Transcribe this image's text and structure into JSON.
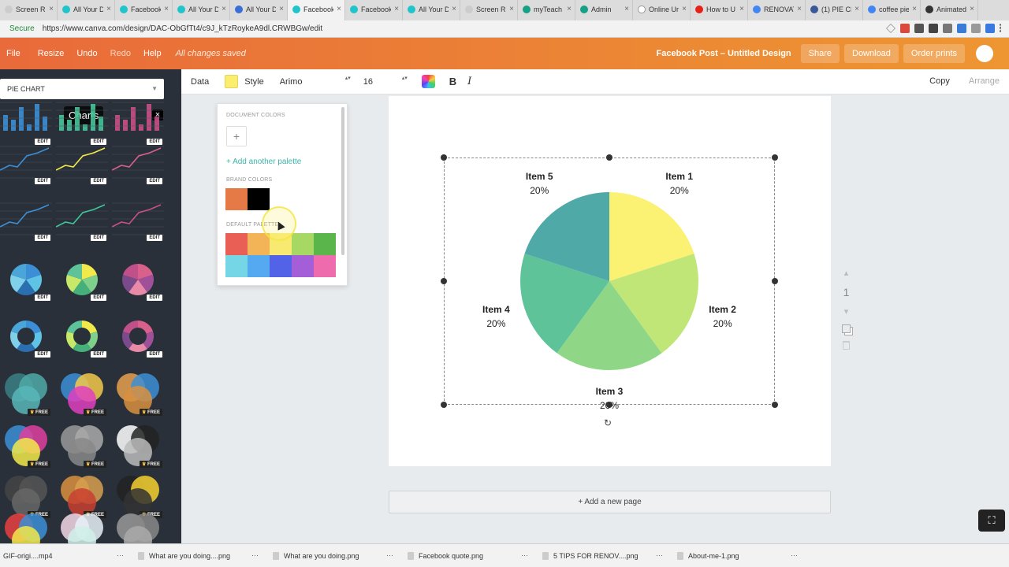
{
  "browser": {
    "tabs": [
      {
        "label": "Screen R",
        "color": "#cccccc"
      },
      {
        "label": "All Your D",
        "color": "#20c4cb"
      },
      {
        "label": "Facebook",
        "color": "#20c4cb"
      },
      {
        "label": "All Your D",
        "color": "#20c4cb"
      },
      {
        "label": "All Your D",
        "color": "#3a6fd8"
      },
      {
        "label": "Facebook",
        "color": "#20c4cb",
        "active": true
      },
      {
        "label": "Facebook",
        "color": "#20c4cb"
      },
      {
        "label": "All Your D",
        "color": "#20c4cb"
      },
      {
        "label": "Screen R",
        "color": "#cccccc"
      },
      {
        "label": "myTeach",
        "color": "#16a085"
      },
      {
        "label": "Admin",
        "color": "#16a085"
      },
      {
        "label": "Online Ur",
        "color": "#ffffff"
      },
      {
        "label": "How to U",
        "color": "#e62117"
      },
      {
        "label": "RENOVAT",
        "color": "#4285f4"
      },
      {
        "label": "(1) PIE CH",
        "color": "#3b5998"
      },
      {
        "label": "coffee pie",
        "color": "#4285f4"
      },
      {
        "label": "Animated",
        "color": "#333333"
      }
    ],
    "close_glyph": "×",
    "secure_label": "Secure",
    "url": "https://www.canva.com/design/DAC-ObGfTt4/c9J_kTzRoykeA9dl.CRWBGw/edit"
  },
  "header": {
    "menu": [
      "File",
      "Resize",
      "Undo",
      "Redo",
      "Help"
    ],
    "saved": "All changes saved",
    "doc_title": "Facebook Post – Untitled Design",
    "share": "Share",
    "download": "Download",
    "order_prints": "Order prints"
  },
  "left_panel": {
    "select_value": "PIE CHART",
    "tooltip": "Charts",
    "close": "×",
    "edit_badge": "EDIT",
    "free_badge": "FREE"
  },
  "toolbar": {
    "data": "Data",
    "style": "Style",
    "font": "Arimo",
    "size": "16",
    "bold": "B",
    "italic": "I",
    "copy": "Copy",
    "arrange": "Arrange",
    "spinner": "▴▾"
  },
  "palette": {
    "document_colors": "DOCUMENT COLORS",
    "add_glyph": "+",
    "add_palette": "+ Add another palette",
    "brand_colors": "BRAND COLORS",
    "brand": [
      "#e57a47",
      "#000000"
    ],
    "default_palette": "DEFAULT PALETTE",
    "default": [
      "#e95f55",
      "#f2b457",
      "#f8ea70",
      "#a7d863",
      "#5ab54a",
      "#75d6e6",
      "#55a9f0",
      "#5263e8",
      "#a45ed8",
      "#ee6bae"
    ]
  },
  "chart_data": {
    "type": "pie",
    "categories": [
      "Item 1",
      "Item 2",
      "Item 3",
      "Item 4",
      "Item 5"
    ],
    "values": [
      20,
      20,
      20,
      20,
      20
    ],
    "labels": [
      "20%",
      "20%",
      "20%",
      "20%",
      "20%"
    ],
    "colors": [
      "#fbf172",
      "#bfe676",
      "#8fd687",
      "#5fc399",
      "#4fa9a7"
    ]
  },
  "canvas": {
    "add_page": "+ Add a new page",
    "rotate_glyph": "↻",
    "page_number": "1"
  },
  "downloads": [
    "GIF-origi....mp4",
    "What are you doing....png",
    "What are you doing.png",
    "Facebook quote.png",
    "5 TIPS FOR RENOV....png",
    "About-me-1.png"
  ],
  "download_more": "⋯",
  "present_glyph": "⛶"
}
